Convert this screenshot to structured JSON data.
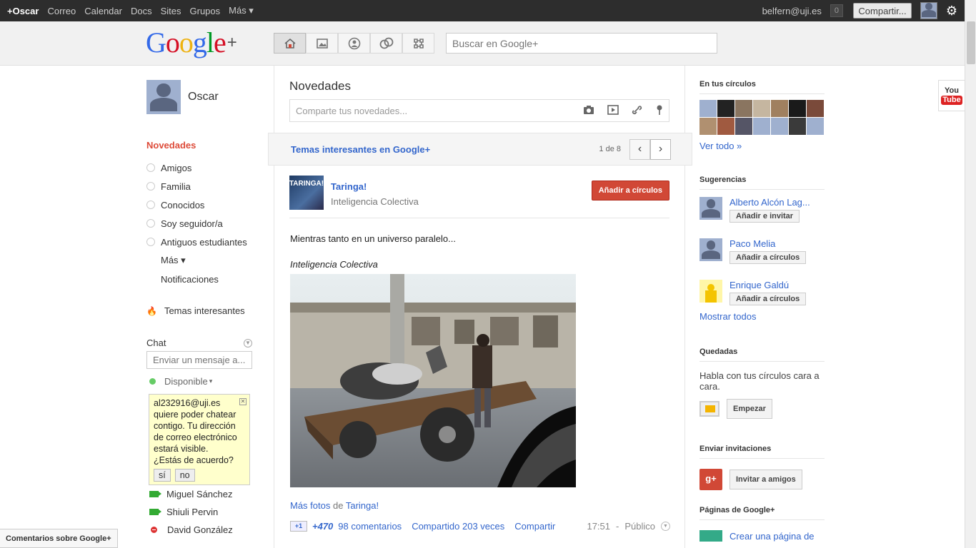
{
  "topbar": {
    "items": [
      "+Oscar",
      "Correo",
      "Calendar",
      "Docs",
      "Sites",
      "Grupos",
      "Más ▾"
    ],
    "email": "belfern@uji.es",
    "notif_count": "0",
    "share_label": "Compartir..."
  },
  "header": {
    "logo_text": "Google",
    "logo_plus": "+",
    "search_placeholder": "Buscar en Google+",
    "nav_icons": [
      "home-icon",
      "photos-icon",
      "profile-icon",
      "circles-icon",
      "games-icon"
    ]
  },
  "left": {
    "profile_name": "Oscar",
    "active_stream": "Novedades",
    "streams": [
      "Amigos",
      "Familia",
      "Conocidos",
      "Soy seguidor/a",
      "Antiguos estudiantes"
    ],
    "more": "Más ▾",
    "notifications": "Notificaciones",
    "temas": "Temas interesantes",
    "chat_label": "Chat",
    "chat_placeholder": "Enviar un mensaje a...",
    "status": "Disponible",
    "invite": {
      "text": "al232916@uji.es quiere poder chatear contigo. Tu dirección de correo electrónico estará visible. ¿Estás de acuerdo?",
      "yes": "sí",
      "no": "no"
    },
    "contacts": [
      {
        "name": "Miguel Sánchez",
        "status": "video"
      },
      {
        "name": "Shiuli Pervin",
        "status": "video"
      },
      {
        "name": "David González",
        "status": "busy"
      }
    ],
    "feedback": "Comentarios sobre Google+"
  },
  "center": {
    "title": "Novedades",
    "share_placeholder": "Comparte tus novedades...",
    "temas_bar": "Temas interesantes en Google+",
    "page_indicator": "1 de 8",
    "post": {
      "thumb_text": "TARINGA!",
      "author": "Taringa!",
      "subtitle": "Inteligencia Colectiva",
      "add_button": "Añadir a círculos",
      "text": "Mientras tanto en un universo paralelo...",
      "caption": "Inteligencia Colectiva",
      "more_photos": "Más fotos",
      "more_photos_de": "de",
      "more_photos_src": "Taringa!",
      "plus1_label": "+1",
      "plus_count": "+470",
      "comments": "98 comentarios",
      "shared": "Compartido 203 veces",
      "share": "Compartir",
      "time": "17:51",
      "separator": "-",
      "visibility": "Público"
    }
  },
  "right": {
    "circles_title": "En tus círculos",
    "see_all": "Ver todo »",
    "suggestions_title": "Sugerencias",
    "suggestions": [
      {
        "name": "Alberto Alcón Lag...",
        "button": "Añadir e invitar"
      },
      {
        "name": "Paco Melia",
        "button": "Añadir a círculos"
      },
      {
        "name": "Enrique Galdú",
        "button": "Añadir a círculos"
      }
    ],
    "show_all": "Mostrar todos",
    "hangouts_title": "Quedadas",
    "hangouts_text": "Habla con tus círculos cara a cara.",
    "start_button": "Empezar",
    "invite_title": "Enviar invitaciones",
    "invite_button": "Invitar a amigos",
    "pages_title": "Páginas de Google+",
    "create_page": "Crear una página de"
  },
  "youtube": {
    "you": "You",
    "tube": "Tube"
  }
}
